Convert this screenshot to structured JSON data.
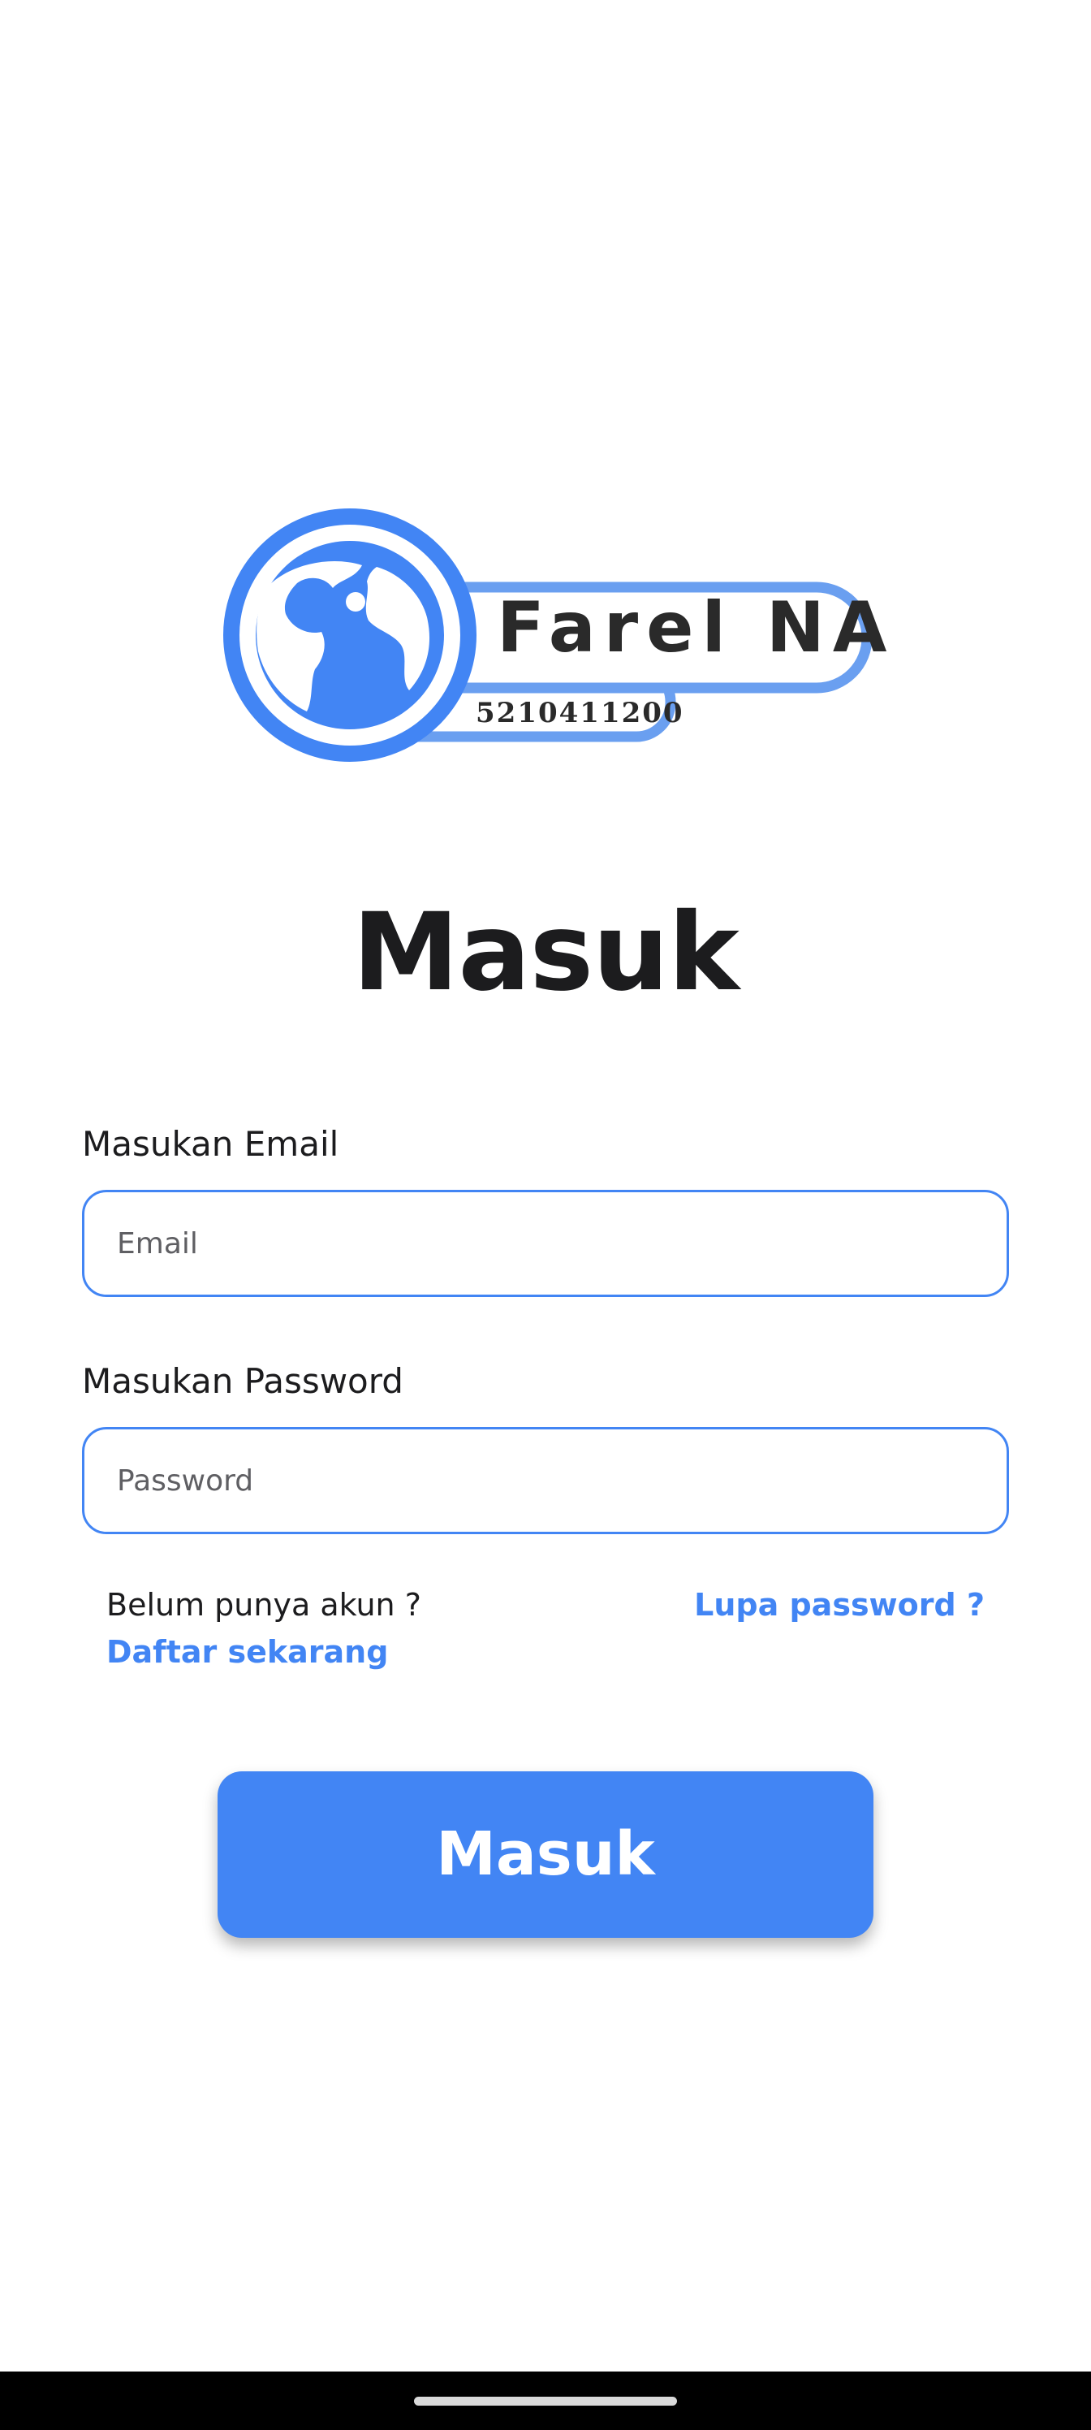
{
  "logo": {
    "name": "Farel NA",
    "id_number": "5210411200",
    "icon": "globe-icon",
    "color": "#4285f4",
    "color_light": "#6a9ff0"
  },
  "title": "Masuk",
  "email": {
    "label": "Masukan Email",
    "placeholder": "Email",
    "value": ""
  },
  "password": {
    "label": "Masukan Password",
    "placeholder": "Password",
    "value": ""
  },
  "links": {
    "no_account": "Belum punya akun ?",
    "signup": "Daftar sekarang",
    "forgot": "Lupa password ?"
  },
  "login_button": {
    "label": "Masuk"
  },
  "colors": {
    "accent": "#4285f4",
    "text": "#1c1c1e",
    "background": "#ffffff",
    "nav_bar": "#000000"
  }
}
